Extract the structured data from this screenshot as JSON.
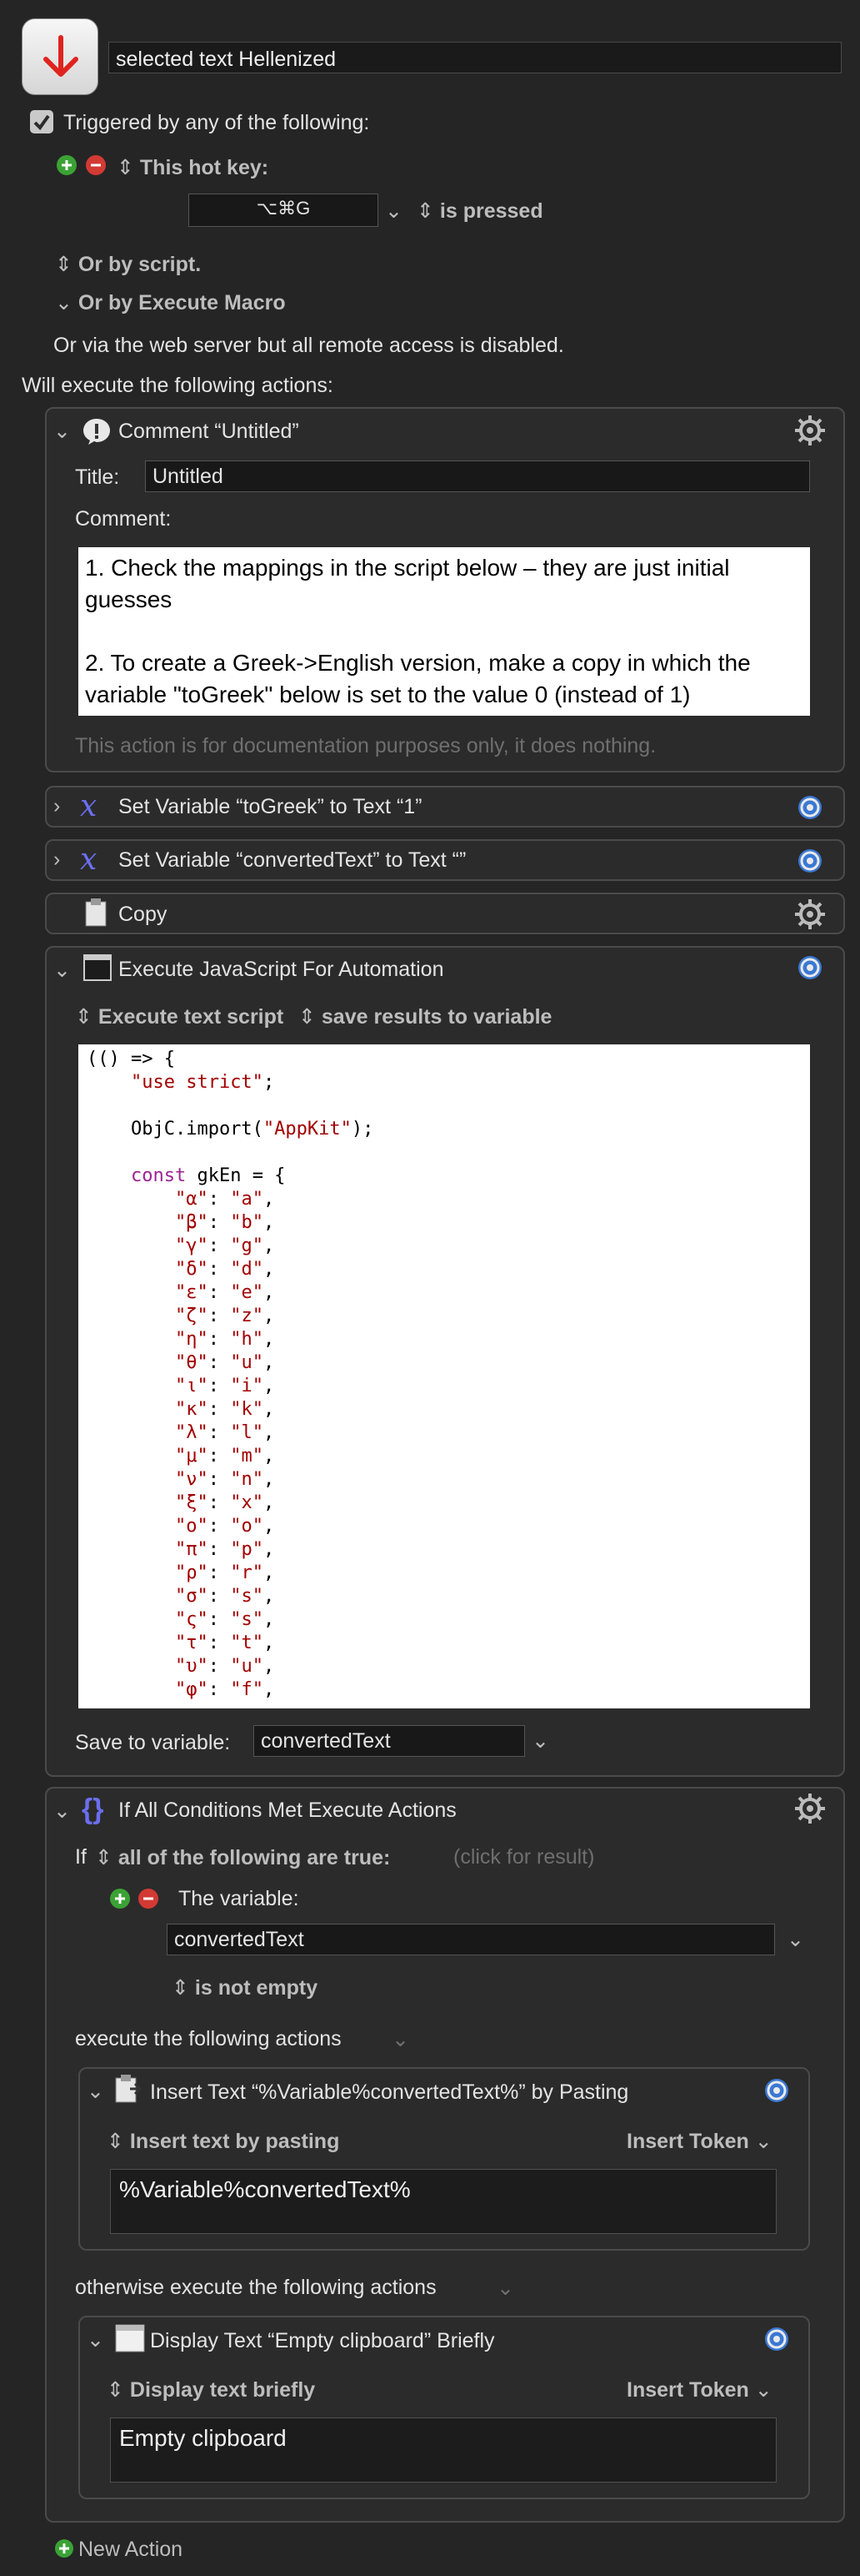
{
  "macro": {
    "name": "selected text Hellenized"
  },
  "triggers": {
    "header": "Triggered by any of the following:",
    "hotkey_label": "This hot key:",
    "hotkey_value": "⌥⌘G",
    "hotkey_state": "is pressed",
    "or_by_script": "Or by script.",
    "or_by_execute_macro": "Or by Execute Macro",
    "web_server": "Or via the web server but all remote access is disabled."
  },
  "will_execute": "Will execute the following actions:",
  "comment_action": {
    "title": "Comment “Untitled”",
    "title_label": "Title:",
    "title_value": "Untitled",
    "comment_label": "Comment:",
    "comment_para1": "1. Check the mappings in the script below – they are just initial guesses",
    "comment_para2": "2. To create a Greek->English version, make a copy in which the variable \"toGreek\" below is set to the value 0 (instead of 1)",
    "note": "This action is for documentation purposes only, it does nothing."
  },
  "set_var1": {
    "title": "Set Variable “toGreek” to Text “1”"
  },
  "set_var2": {
    "title": "Set Variable “convertedText” to Text “”"
  },
  "copy_action": {
    "title": "Copy"
  },
  "jxa_action": {
    "title": "Execute JavaScript For Automation",
    "mode": "Execute text script",
    "result_mode": "save results to variable",
    "code_lines": [
      "(() => {",
      "    \"use strict\";",
      "",
      "    ObjC.import(\"AppKit\");",
      "",
      "    const gkEn = {",
      "        \"α\": \"a\",",
      "        \"β\": \"b\",",
      "        \"γ\": \"g\",",
      "        \"δ\": \"d\",",
      "        \"ε\": \"e\",",
      "        \"ζ\": \"z\",",
      "        \"η\": \"h\",",
      "        \"θ\": \"u\",",
      "        \"ι\": \"i\",",
      "        \"κ\": \"k\",",
      "        \"λ\": \"l\",",
      "        \"μ\": \"m\",",
      "        \"ν\": \"n\",",
      "        \"ξ\": \"x\",",
      "        \"ο\": \"o\",",
      "        \"π\": \"p\",",
      "        \"ρ\": \"r\",",
      "        \"σ\": \"s\",",
      "        \"ς\": \"s\",",
      "        \"τ\": \"t\",",
      "        \"υ\": \"u\",",
      "        \"φ\": \"f\","
    ],
    "save_label": "Save to variable:",
    "save_value": "convertedText"
  },
  "if_action": {
    "title": "If All Conditions Met Execute Actions",
    "if_label": "If",
    "condition_mode": "all of the following are true:",
    "click_result": "(click for result)",
    "variable_label": "The variable:",
    "variable_value": "convertedText",
    "condition": "is not empty",
    "then_label": "execute the following actions",
    "else_label": "otherwise execute the following actions"
  },
  "insert_action": {
    "title": "Insert Text “%Variable%convertedText%” by Pasting",
    "mode": "Insert text by pasting",
    "token": "Insert Token",
    "text": "%Variable%convertedText%"
  },
  "display_action": {
    "title": "Display Text “Empty clipboard” Briefly",
    "mode": "Display text briefly",
    "token": "Insert Token",
    "text": "Empty clipboard"
  },
  "new_action": "New Action"
}
